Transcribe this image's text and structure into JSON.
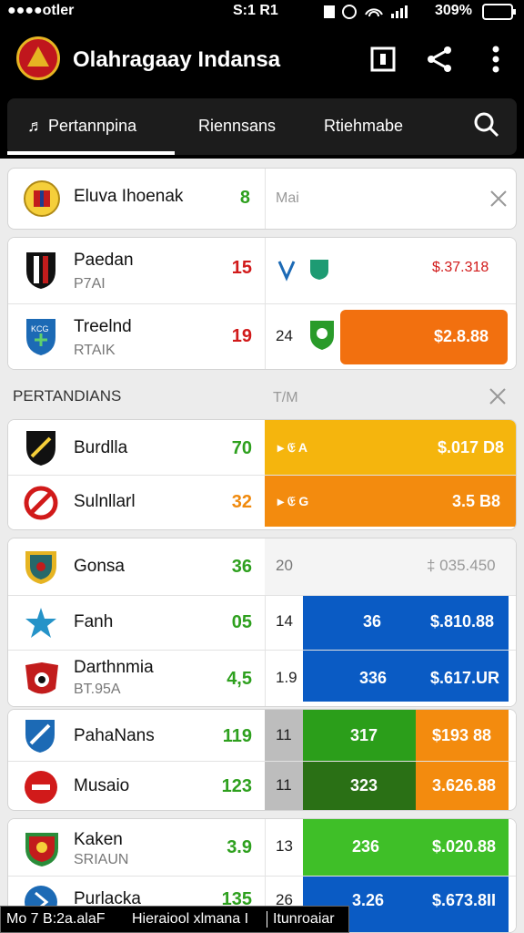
{
  "status_bar": {
    "left": "●●●●otler",
    "time": "S:1 R1",
    "battery": "309%"
  },
  "app": {
    "title": "Olahragaay Indansa",
    "accent": "#c0161d"
  },
  "tabs": [
    {
      "label": "Pertannpina",
      "active": true
    },
    {
      "label": "Riennsans",
      "active": false
    },
    {
      "label": "Rtiehmabe",
      "active": false
    }
  ],
  "featured": {
    "name": "Eluva Ihoenak",
    "score": "8",
    "tag": "Mai"
  },
  "group_a": [
    {
      "name": "Paedan",
      "sub": "P7AI",
      "score": "15",
      "score_color": "#d11a1a",
      "right_value": "$.37.318"
    },
    {
      "name": "Treelnd",
      "sub": "RTAIK",
      "score": "19",
      "score_color": "#d11a1a",
      "sub_score": "24",
      "value": "$2.8.88"
    }
  ],
  "section": {
    "title": "PERTANDIANS",
    "tag": "T/M"
  },
  "group_b": [
    {
      "name": "Burdlla",
      "score": "70",
      "score_color": "#2ea01e",
      "detail": "▸ 𝔈 A",
      "value": "$.017 D8"
    },
    {
      "name": "Sulnllarl",
      "score": "32",
      "score_color": "#f08a0e",
      "detail": "▸ 𝔈 G",
      "value": "3.5 B8"
    }
  ],
  "group_c": [
    {
      "name": "Gonsa",
      "score": "36",
      "score_color": "#2ea01e",
      "col1": "20",
      "value": "‡ 035.450"
    },
    {
      "name": "Fanh",
      "score": "05",
      "score_color": "#2ea01e",
      "col1": "14",
      "col2": "36",
      "value": "$.810.88"
    },
    {
      "name": "Darthnmia",
      "sub": "BT.95A",
      "score": "4,5",
      "score_color": "#2ea01e",
      "col1": "1.9",
      "col2": "336",
      "value": "$.617.UR"
    }
  ],
  "group_d": [
    {
      "name": "PahaNans",
      "score": "119",
      "score_color": "#2ea01e",
      "col1": "11",
      "col2": "317",
      "value": "$193 88"
    },
    {
      "name": "Musaio",
      "score": "123",
      "score_color": "#2ea01e",
      "col1": "11",
      "col2": "323",
      "value": "3.626.88"
    }
  ],
  "group_e": [
    {
      "name": "Kaken",
      "sub": "SRIAUN",
      "score": "3.9",
      "score_color": "#2ea01e",
      "col1": "13",
      "col2": "236",
      "value": "$.020.88"
    },
    {
      "name": "Purlacka",
      "score": "135",
      "score_color": "#2ea01e",
      "col1": "26",
      "col2": "3.26",
      "value": "$.673.8II"
    }
  ],
  "footer": {
    "left": "Mo 7 B:2a.alaF",
    "middle": "Hieraiool xlmana I",
    "right": "Itunroaiar"
  },
  "colors": {
    "orange": "#f2700f",
    "yellow": "#f5b50d",
    "dark_orange": "#f38b0e",
    "blue": "#0a5bc4",
    "green": "#2b9e1a",
    "dark_green": "#2a7015",
    "light_green": "#3fbf28",
    "gray": "#bdbdbd"
  }
}
